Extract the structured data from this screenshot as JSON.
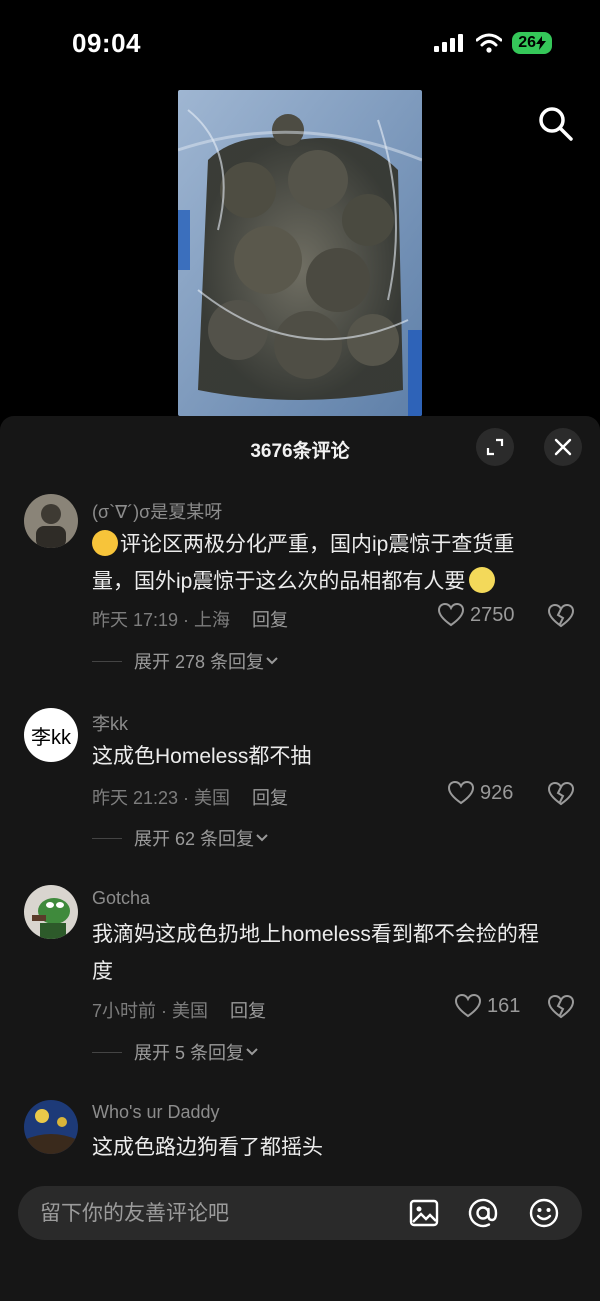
{
  "status_bar": {
    "time": "09:04",
    "battery": "26"
  },
  "comments_panel": {
    "title": "3676条评论",
    "comments": [
      {
        "username": "(σ`∇´)σ是夏某呀",
        "text_line1": "评论区两极分化严重，国内ip震惊于查货重",
        "text_line2": "量，国外ip震惊于这么次的品相都有人要",
        "time_location": "昨天 17:19 · 上海",
        "reply_label": "回复",
        "likes": "2750",
        "expand_label": "展开 278 条回复"
      },
      {
        "username": "李kk",
        "avatar_text": "李kk",
        "text_line1": "这成色Homeless都不抽",
        "time_location": "昨天 21:23 · 美国",
        "reply_label": "回复",
        "likes": "926",
        "expand_label": "展开 62 条回复"
      },
      {
        "username": "Gotcha",
        "text_line1": "我滴妈这成色扔地上homeless看到都不会捡的程",
        "text_line2": "度",
        "time_location": "7小时前 · 美国",
        "reply_label": "回复",
        "likes": "161",
        "expand_label": "展开 5 条回复"
      },
      {
        "username": "Who's ur Daddy",
        "text_line1": "这成色路边狗看了都摇头"
      }
    ]
  },
  "input_bar": {
    "placeholder": "留下你的友善评论吧"
  },
  "icons": {
    "search": "search-icon",
    "expand": "expand-icon",
    "close": "close-icon",
    "heart": "heart-icon",
    "dislike": "broken-heart-icon",
    "image": "image-icon",
    "mention": "at-mention-icon",
    "emoji": "emoji-icon"
  },
  "colors": {
    "panel_bg": "#161616",
    "battery": "#35c759"
  }
}
